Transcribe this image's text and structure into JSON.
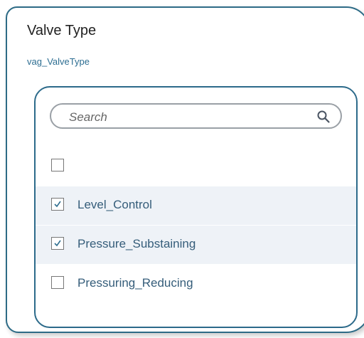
{
  "field": {
    "title": "Valve Type",
    "subtitle": "vag_ValveType"
  },
  "search": {
    "placeholder": "Search",
    "icon": "search-icon"
  },
  "options": [
    {
      "label": "",
      "checked": false
    },
    {
      "label": "Level_Control",
      "checked": true
    },
    {
      "label": "Pressure_Substaining",
      "checked": true
    },
    {
      "label": "Pressuring_Reducing",
      "checked": false
    }
  ],
  "colors": {
    "border": "#2d6b86",
    "link_text": "#2d6e92",
    "option_text": "#355d7a",
    "selected_row_bg": "#eef2f7"
  }
}
